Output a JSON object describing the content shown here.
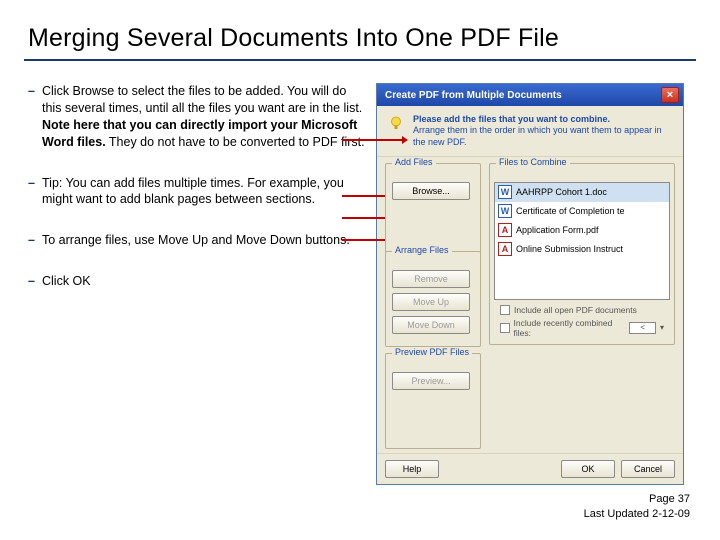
{
  "title": "Merging Several Documents Into One PDF File",
  "bullets": [
    {
      "pre": "Click Browse to select the files to be added. You will do this several times, until all the files you want are in the list. ",
      "bold": "Note here that you can directly import your Microsoft Word files.",
      "post": " They do not have to be converted to PDF first."
    },
    {
      "pre": "Tip: You can add files multiple times. For example, you might want to add blank pages between sections.",
      "bold": "",
      "post": ""
    },
    {
      "pre": "To arrange files, use Move Up and Move Down buttons.",
      "bold": "",
      "post": ""
    },
    {
      "pre": "Click OK",
      "bold": "",
      "post": ""
    }
  ],
  "dialog": {
    "title": "Create PDF from Multiple Documents",
    "hint_line1": "Please add the files that you want to combine.",
    "hint_line2": "Arrange them in the order in which you want them to appear in the new PDF.",
    "groups": {
      "add": "Add Files",
      "arrange": "Arrange Files",
      "preview": "Preview PDF Files",
      "files": "Files to Combine"
    },
    "buttons": {
      "browse": "Browse...",
      "remove": "Remove",
      "moveup": "Move Up",
      "movedown": "Move Down",
      "preview": "Preview...",
      "help": "Help",
      "ok": "OK",
      "cancel": "Cancel"
    },
    "files": [
      {
        "icon": "word",
        "name": "AAHRPP Cohort 1.doc"
      },
      {
        "icon": "word",
        "name": "Certificate of Completion te"
      },
      {
        "icon": "pdf",
        "name": "Application Form.pdf"
      },
      {
        "icon": "pdf",
        "name": "Online Submission Instruct"
      }
    ],
    "opts": {
      "include_open": "Include all open PDF documents",
      "include_recent": "Include recently combined files:",
      "recent_sel": "<"
    }
  },
  "footer": {
    "page": "Page 37",
    "updated": "Last Updated 2-12-09"
  }
}
